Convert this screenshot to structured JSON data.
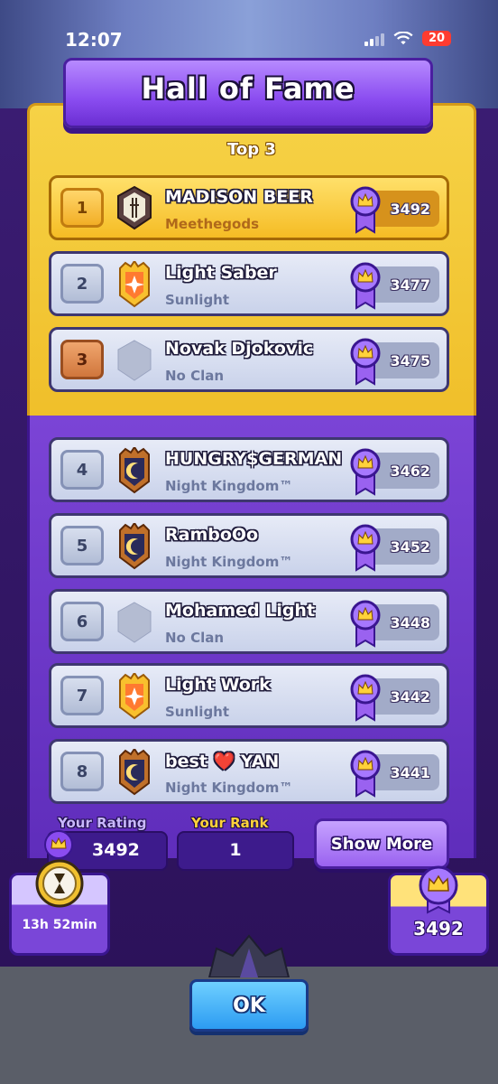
{
  "status_bar": {
    "time": "12:07",
    "battery": "20"
  },
  "header": {
    "title": "Hall of Fame",
    "top3_label": "Top 3"
  },
  "players": [
    {
      "rank": "1",
      "name": "MADISON BEER",
      "clan": "Meethegods",
      "score": "3492",
      "badge": "bamboo-badge",
      "style": "gold"
    },
    {
      "rank": "2",
      "name": "Light Saber",
      "clan": "Sunlight",
      "score": "3477",
      "badge": "sun-badge",
      "style": "silver"
    },
    {
      "rank": "3",
      "name": "Novak Djokovic",
      "clan": "No Clan",
      "score": "3475",
      "badge": "no-clan-badge",
      "style": "bronze"
    },
    {
      "rank": "4",
      "name": "HUNGRY$GERMAN",
      "clan": "Night Kingdom™",
      "score": "3462",
      "badge": "moon-badge",
      "style": "silver"
    },
    {
      "rank": "5",
      "name": "RamboOo",
      "clan": "Night Kingdom™",
      "score": "3452",
      "badge": "moon-badge",
      "style": "silver"
    },
    {
      "rank": "6",
      "name": "Mohamed Light",
      "clan": "No Clan",
      "score": "3448",
      "badge": "no-clan-badge",
      "style": "silver"
    },
    {
      "rank": "7",
      "name": "Light Work",
      "clan": "Sunlight",
      "score": "3442",
      "badge": "sun-badge",
      "style": "silver"
    },
    {
      "rank": "8",
      "name": "best ❤️ YAN",
      "clan": "Night Kingdom™",
      "score": "3441",
      "badge": "moon-badge",
      "style": "silver"
    }
  ],
  "footer": {
    "your_rating_label": "Your Rating",
    "your_rating": "3492",
    "your_rank_label": "Your Rank",
    "your_rank": "1",
    "show_more": "Show More",
    "timer": "13h 52min",
    "reward_score": "3492",
    "ok": "OK"
  },
  "colors": {
    "gold": "#f5bc24",
    "purple": "#7b44d6",
    "silver": "#c9d2ea",
    "accent_blue": "#2c9cf2"
  }
}
